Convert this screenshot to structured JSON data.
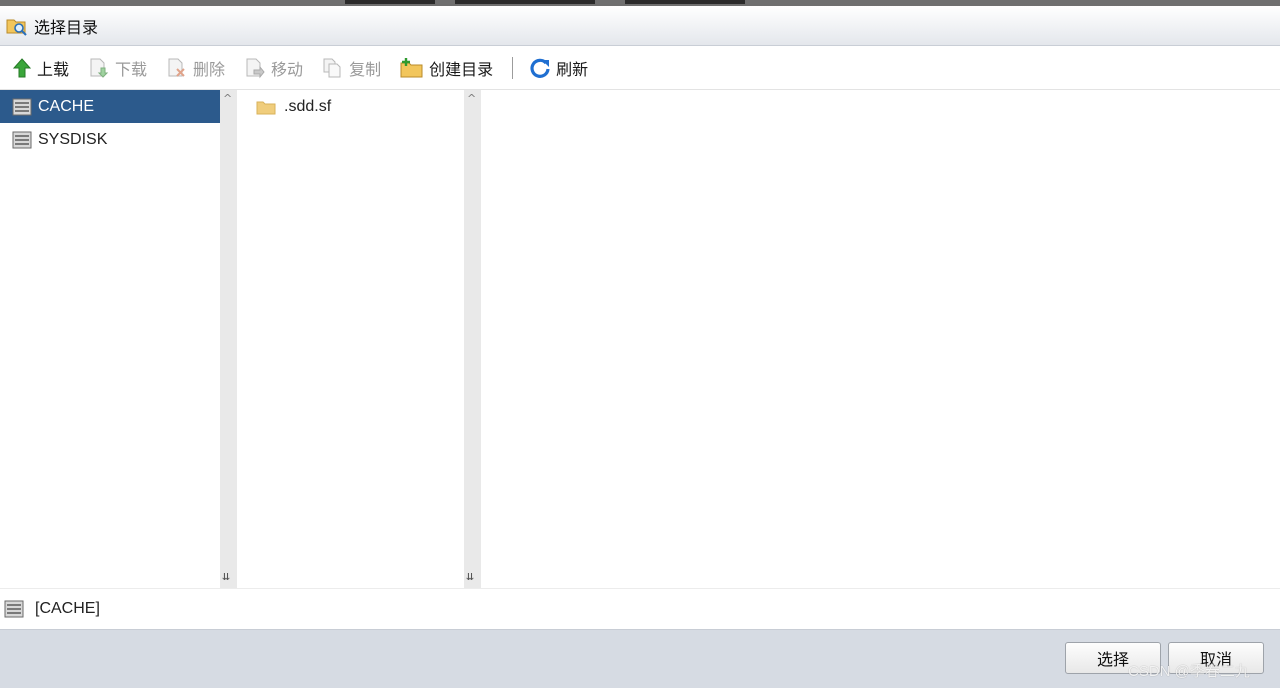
{
  "window": {
    "title": "选择目录",
    "icon": "folder-search-icon"
  },
  "toolbar": {
    "upload": {
      "label": "上载",
      "icon": "upload-arrow-icon",
      "enabled": true
    },
    "download": {
      "label": "下载",
      "icon": "download-icon",
      "enabled": false
    },
    "delete": {
      "label": "删除",
      "icon": "delete-icon",
      "enabled": false
    },
    "move": {
      "label": "移动",
      "icon": "move-icon",
      "enabled": false
    },
    "copy": {
      "label": "复制",
      "icon": "copy-icon",
      "enabled": false
    },
    "create_dir": {
      "label": "创建目录",
      "icon": "new-folder-icon",
      "enabled": true
    },
    "refresh": {
      "label": "刷新",
      "icon": "refresh-icon",
      "enabled": true
    }
  },
  "drives": [
    {
      "label": "CACHE",
      "icon": "drive-icon",
      "selected": true
    },
    {
      "label": "SYSDISK",
      "icon": "drive-icon",
      "selected": false
    }
  ],
  "files": [
    {
      "label": ".sdd.sf",
      "icon": "folder-icon"
    }
  ],
  "path": {
    "label": "[CACHE]",
    "icon": "drive-icon"
  },
  "footer": {
    "select_label": "选择",
    "cancel_label": "取消",
    "watermark": "CSDN @季春二九"
  },
  "colors": {
    "selection": "#2c5a8c",
    "footer_bg": "#d6dbe3",
    "accent_green": "#3aa63a",
    "accent_blue": "#1f6fd1"
  }
}
